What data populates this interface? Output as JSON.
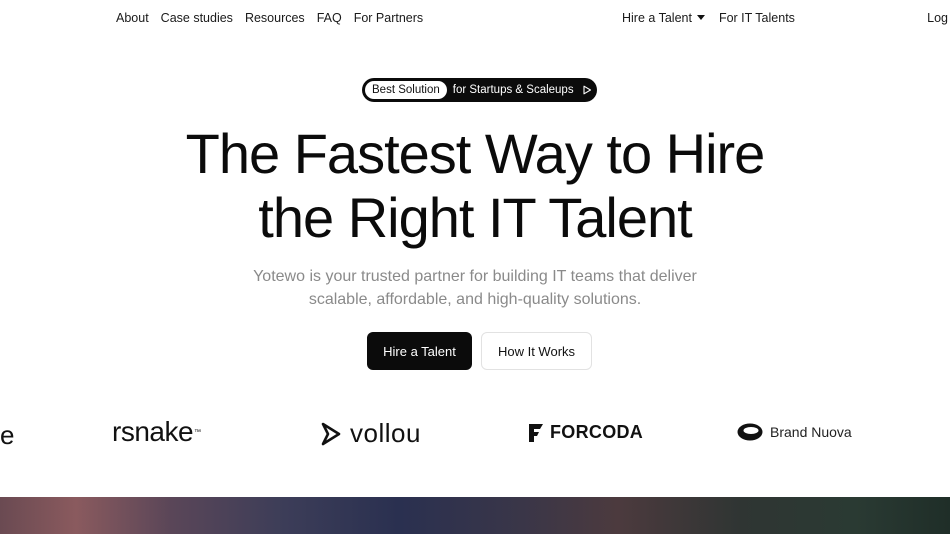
{
  "nav": {
    "left_items": [
      "About",
      "Case studies",
      "Resources",
      "FAQ",
      "For Partners"
    ],
    "hire_label": "Hire a Talent",
    "it_talents_label": "For IT Talents",
    "login_label": "Log"
  },
  "hero": {
    "badge": "Best Solution",
    "pill_text": "for Startups & Scaleups",
    "headline_line1": "The Fastest Way to Hire",
    "headline_line2": "the Right IT Talent",
    "sub_line1": "Yotewo is your trusted partner for building IT teams that deliver",
    "sub_line2": "scalable, affordable, and high-quality solutions.",
    "primary_button": "Hire a Talent",
    "secondary_button": "How It Works"
  },
  "logos": {
    "partial": "e",
    "rsnake": "rsnake",
    "rsnake_tm": "™",
    "vollou": "vollou",
    "forcoda": "FORCODA",
    "brand_nuova": "Brand Nuova"
  }
}
